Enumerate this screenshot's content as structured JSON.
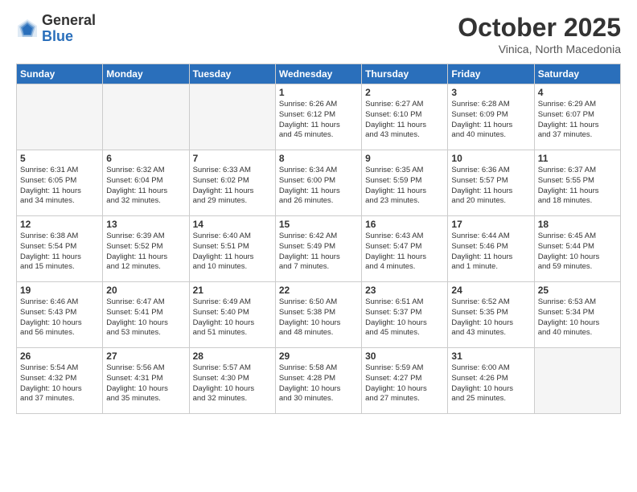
{
  "logo": {
    "general": "General",
    "blue": "Blue"
  },
  "title": "October 2025",
  "subtitle": "Vinica, North Macedonia",
  "weekdays": [
    "Sunday",
    "Monday",
    "Tuesday",
    "Wednesday",
    "Thursday",
    "Friday",
    "Saturday"
  ],
  "weeks": [
    [
      {
        "day": "",
        "info": ""
      },
      {
        "day": "",
        "info": ""
      },
      {
        "day": "",
        "info": ""
      },
      {
        "day": "1",
        "info": "Sunrise: 6:26 AM\nSunset: 6:12 PM\nDaylight: 11 hours\nand 45 minutes."
      },
      {
        "day": "2",
        "info": "Sunrise: 6:27 AM\nSunset: 6:10 PM\nDaylight: 11 hours\nand 43 minutes."
      },
      {
        "day": "3",
        "info": "Sunrise: 6:28 AM\nSunset: 6:09 PM\nDaylight: 11 hours\nand 40 minutes."
      },
      {
        "day": "4",
        "info": "Sunrise: 6:29 AM\nSunset: 6:07 PM\nDaylight: 11 hours\nand 37 minutes."
      }
    ],
    [
      {
        "day": "5",
        "info": "Sunrise: 6:31 AM\nSunset: 6:05 PM\nDaylight: 11 hours\nand 34 minutes."
      },
      {
        "day": "6",
        "info": "Sunrise: 6:32 AM\nSunset: 6:04 PM\nDaylight: 11 hours\nand 32 minutes."
      },
      {
        "day": "7",
        "info": "Sunrise: 6:33 AM\nSunset: 6:02 PM\nDaylight: 11 hours\nand 29 minutes."
      },
      {
        "day": "8",
        "info": "Sunrise: 6:34 AM\nSunset: 6:00 PM\nDaylight: 11 hours\nand 26 minutes."
      },
      {
        "day": "9",
        "info": "Sunrise: 6:35 AM\nSunset: 5:59 PM\nDaylight: 11 hours\nand 23 minutes."
      },
      {
        "day": "10",
        "info": "Sunrise: 6:36 AM\nSunset: 5:57 PM\nDaylight: 11 hours\nand 20 minutes."
      },
      {
        "day": "11",
        "info": "Sunrise: 6:37 AM\nSunset: 5:55 PM\nDaylight: 11 hours\nand 18 minutes."
      }
    ],
    [
      {
        "day": "12",
        "info": "Sunrise: 6:38 AM\nSunset: 5:54 PM\nDaylight: 11 hours\nand 15 minutes."
      },
      {
        "day": "13",
        "info": "Sunrise: 6:39 AM\nSunset: 5:52 PM\nDaylight: 11 hours\nand 12 minutes."
      },
      {
        "day": "14",
        "info": "Sunrise: 6:40 AM\nSunset: 5:51 PM\nDaylight: 11 hours\nand 10 minutes."
      },
      {
        "day": "15",
        "info": "Sunrise: 6:42 AM\nSunset: 5:49 PM\nDaylight: 11 hours\nand 7 minutes."
      },
      {
        "day": "16",
        "info": "Sunrise: 6:43 AM\nSunset: 5:47 PM\nDaylight: 11 hours\nand 4 minutes."
      },
      {
        "day": "17",
        "info": "Sunrise: 6:44 AM\nSunset: 5:46 PM\nDaylight: 11 hours\nand 1 minute."
      },
      {
        "day": "18",
        "info": "Sunrise: 6:45 AM\nSunset: 5:44 PM\nDaylight: 10 hours\nand 59 minutes."
      }
    ],
    [
      {
        "day": "19",
        "info": "Sunrise: 6:46 AM\nSunset: 5:43 PM\nDaylight: 10 hours\nand 56 minutes."
      },
      {
        "day": "20",
        "info": "Sunrise: 6:47 AM\nSunset: 5:41 PM\nDaylight: 10 hours\nand 53 minutes."
      },
      {
        "day": "21",
        "info": "Sunrise: 6:49 AM\nSunset: 5:40 PM\nDaylight: 10 hours\nand 51 minutes."
      },
      {
        "day": "22",
        "info": "Sunrise: 6:50 AM\nSunset: 5:38 PM\nDaylight: 10 hours\nand 48 minutes."
      },
      {
        "day": "23",
        "info": "Sunrise: 6:51 AM\nSunset: 5:37 PM\nDaylight: 10 hours\nand 45 minutes."
      },
      {
        "day": "24",
        "info": "Sunrise: 6:52 AM\nSunset: 5:35 PM\nDaylight: 10 hours\nand 43 minutes."
      },
      {
        "day": "25",
        "info": "Sunrise: 6:53 AM\nSunset: 5:34 PM\nDaylight: 10 hours\nand 40 minutes."
      }
    ],
    [
      {
        "day": "26",
        "info": "Sunrise: 5:54 AM\nSunset: 4:32 PM\nDaylight: 10 hours\nand 37 minutes."
      },
      {
        "day": "27",
        "info": "Sunrise: 5:56 AM\nSunset: 4:31 PM\nDaylight: 10 hours\nand 35 minutes."
      },
      {
        "day": "28",
        "info": "Sunrise: 5:57 AM\nSunset: 4:30 PM\nDaylight: 10 hours\nand 32 minutes."
      },
      {
        "day": "29",
        "info": "Sunrise: 5:58 AM\nSunset: 4:28 PM\nDaylight: 10 hours\nand 30 minutes."
      },
      {
        "day": "30",
        "info": "Sunrise: 5:59 AM\nSunset: 4:27 PM\nDaylight: 10 hours\nand 27 minutes."
      },
      {
        "day": "31",
        "info": "Sunrise: 6:00 AM\nSunset: 4:26 PM\nDaylight: 10 hours\nand 25 minutes."
      },
      {
        "day": "",
        "info": ""
      }
    ]
  ]
}
